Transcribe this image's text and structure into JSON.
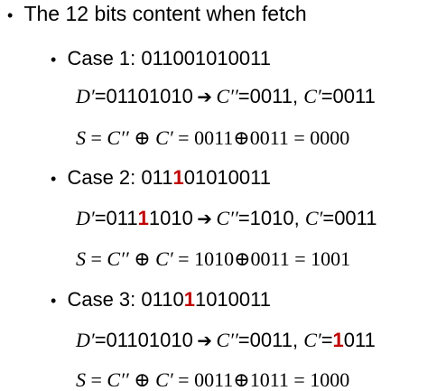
{
  "heading": {
    "bullet": "•",
    "text": "The 12 bits content when fetch"
  },
  "cases": [
    {
      "label_prefix": "Case 1: ",
      "bits_a": "011001010011",
      "bits_red": "",
      "bits_b": "",
      "d_line": {
        "d_name": "D′",
        "d_value": "=01101010",
        "arrow": "➔",
        "c2_name": "C′′",
        "c2_value": "=0011, ",
        "c1_name": "C′",
        "c1_eq": "=",
        "c1_red": "",
        "c1_rest": "0011"
      },
      "s_line": {
        "s": "S",
        "lhs": " = ",
        "c2": "C′′",
        "op": " ⊕ ",
        "c1": "C′",
        "rhs": " = 0011⊕0011 = 0000"
      }
    },
    {
      "label_prefix": "Case 2: ",
      "bits_a": "011",
      "bits_red": "1",
      "bits_b": "01010011",
      "d_line": {
        "d_name": "D′",
        "d_value_a": "=011",
        "d_value_red": "1",
        "d_value_b": "1010",
        "arrow": "➔",
        "c2_name": "C′′",
        "c2_value": "=1010, ",
        "c1_name": "C′",
        "c1_eq": "=",
        "c1_red": "",
        "c1_rest": "0011"
      },
      "s_line": {
        "s": "S",
        "lhs": " = ",
        "c2": "C′′",
        "op": " ⊕ ",
        "c1": "C′",
        "rhs": " = 1010⊕0011 = 1001"
      }
    },
    {
      "label_prefix": "Case 3: ",
      "bits_a": "0110",
      "bits_red": "1",
      "bits_b": "1010011",
      "d_line": {
        "d_name": "D′",
        "d_value": "=01101010",
        "arrow": "➔",
        "c2_name": "C′′",
        "c2_value": "=0011, ",
        "c1_name": "C′",
        "c1_eq": "=",
        "c1_red": "1",
        "c1_rest": "011"
      },
      "s_line": {
        "s": "S",
        "lhs": " = ",
        "c2": "C′′",
        "op": " ⊕ ",
        "c1": "C′",
        "rhs": " = 0011⊕1011 = 1000"
      }
    }
  ],
  "bullets": {
    "level1": "•",
    "level2": "•"
  },
  "colors": {
    "text": "#000000",
    "highlight": "#c00000",
    "background": "#ffffff"
  }
}
